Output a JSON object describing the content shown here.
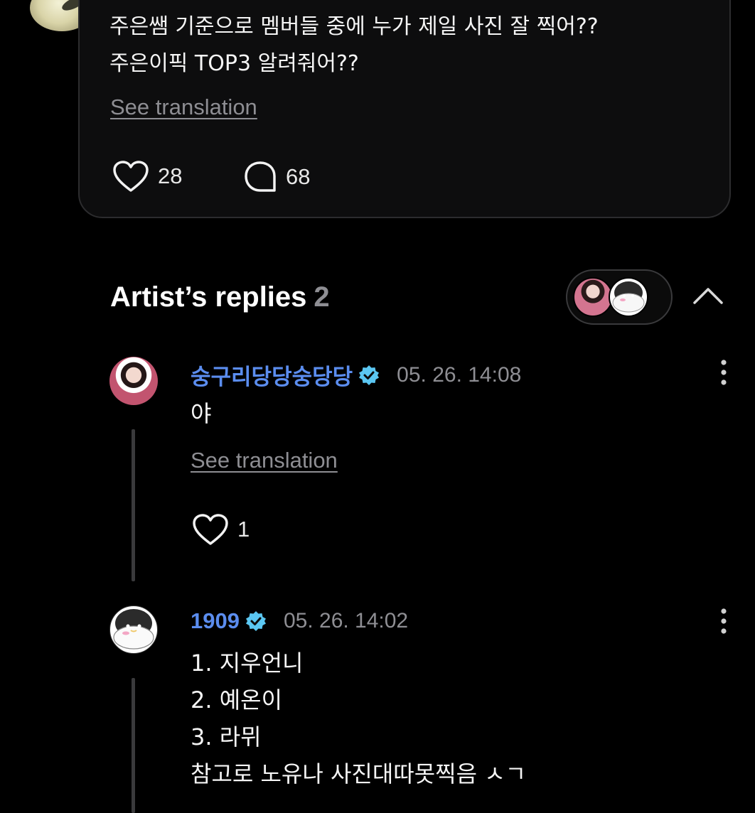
{
  "post": {
    "text_line1": "주은쌤 기준으로 멤버들 중에 누가 제일 사진 잘 찍어??",
    "text_line2": "주은이픽 TOP3 알려줘어??",
    "see_translation": "See translation",
    "like_count": "28",
    "comment_count": "68"
  },
  "artist_replies": {
    "title": "Artist’s replies",
    "count": "2"
  },
  "replies": [
    {
      "author": "숭구리당당숭당당",
      "verified": true,
      "timestamp": "05. 26. 14:08",
      "text": "야",
      "see_translation": "See translation",
      "like_count": "1"
    },
    {
      "author": "1909",
      "verified": true,
      "timestamp": "05. 26. 14:02",
      "lines": [
        "1. 지우언니",
        "2. 예온이",
        "3. 라뮈",
        "참고로 노유나 사진대따못찍음 ㅅㄱ"
      ]
    }
  ],
  "colors": {
    "background": "#000000",
    "card": "#0d0d0e",
    "author_name": "#5b8def",
    "verified_badge": "#5bc7f2",
    "muted_text": "#8e8e93"
  },
  "icons": {
    "like": "heart-outline-icon",
    "comment": "speech-bubble-icon",
    "verified": "verified-badge-icon",
    "more": "vertical-dots-icon",
    "collapse": "chevron-up-icon"
  }
}
